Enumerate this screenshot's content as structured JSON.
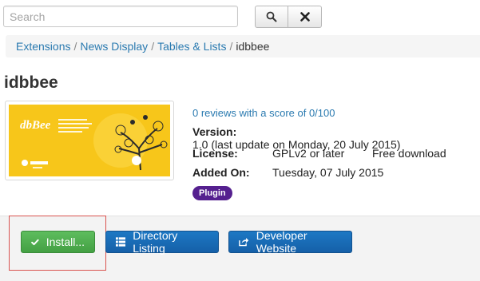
{
  "search": {
    "placeholder": "Search"
  },
  "toolbar": {
    "search_icon": "search-icon",
    "clear_icon": "close-icon"
  },
  "breadcrumb": {
    "items": [
      "Extensions",
      "News Display",
      "Tables & Lists"
    ],
    "separator": "/",
    "current": "idbbee"
  },
  "extension": {
    "title": "idbbee",
    "thumbnail_brand": "dbBee",
    "reviews": "0 reviews with a score of 0/100",
    "version_label": "Version:",
    "version_value": "1.0 (last update on Monday, 20 July 2015)",
    "license_label": "License:",
    "license_value": "GPLv2 or later",
    "free_download": "Free download",
    "added_label": "Added On:",
    "added_value": "Tuesday, 07 July 2015",
    "badge": "Plugin"
  },
  "actions": {
    "install": "Install...",
    "directory": "Directory Listing",
    "developer": "Developer Website"
  },
  "colors": {
    "link": "#2a7ab0",
    "install_green": "#4cae4c",
    "primary_blue": "#1a6fbd",
    "plugin_badge": "#55208f",
    "highlight_red": "#d9534f",
    "thumbnail_yellow": "#f7c61a"
  }
}
